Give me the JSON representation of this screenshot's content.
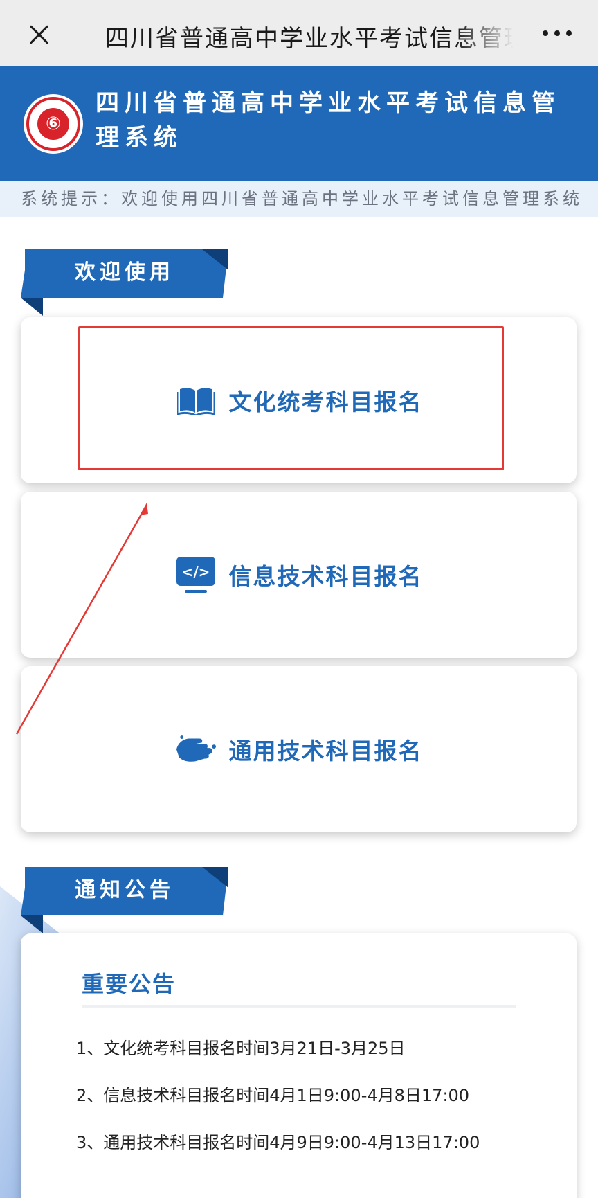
{
  "nav": {
    "title": "四川省普通高中学业水平考试信息管理系统",
    "close_icon": "close-icon",
    "more_icon": "more-dots-icon"
  },
  "header": {
    "title": "四川省普通高中学业水平考试信息管理系统",
    "logo_icon": "seal-logo-icon"
  },
  "notice": {
    "text": "系统提示：欢迎使用四川省普通高中学业水平考试信息管理系统"
  },
  "sections": {
    "welcome": "欢迎使用",
    "announcements": "通知公告"
  },
  "cards": [
    {
      "label": "文化统考科目报名",
      "icon": "book-icon"
    },
    {
      "label": "信息技术科目报名",
      "icon": "code-monitor-icon"
    },
    {
      "label": "通用技术科目报名",
      "icon": "handshake-icon"
    }
  ],
  "announcement": {
    "title": "重要公告",
    "items": [
      "1、文化统考科目报名时间3月21日-3月25日",
      "2、信息技术科目报名时间4月1日9:00-4月8日17:00",
      "3、通用技术科目报名时间4月9日9:00-4月13日17:00"
    ]
  },
  "colors": {
    "primary": "#1f69b8",
    "highlight": "#e53935",
    "logo_red": "#d8232a"
  }
}
